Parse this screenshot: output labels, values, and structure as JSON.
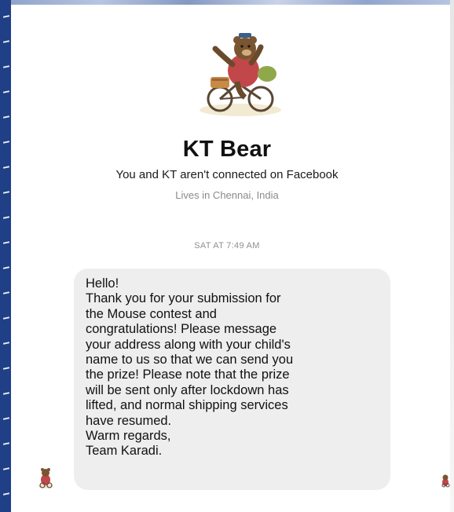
{
  "profile": {
    "name": "KT Bear",
    "connection_status": "You and KT aren't connected on Facebook",
    "location": "Lives in Chennai, India",
    "avatar_icon": "bear-riding-bicycle-icon"
  },
  "conversation": {
    "timestamp": "SAT AT 7:49 AM",
    "message_lines": [
      "Hello!",
      "Thank you for your submission for",
      "the Mouse contest and",
      "congratulations! Please message",
      "your address along with your child's",
      "name to us so that we can send you",
      "the prize! Please note that the prize",
      "will be sent only after lockdown has",
      "lifted, and normal shipping services",
      "have resumed.",
      "Warm regards,",
      "Team Karadi."
    ]
  },
  "colors": {
    "left_border": "#1f3f86",
    "bubble_background": "#eeeeee",
    "secondary_text": "#8a8a8a"
  }
}
